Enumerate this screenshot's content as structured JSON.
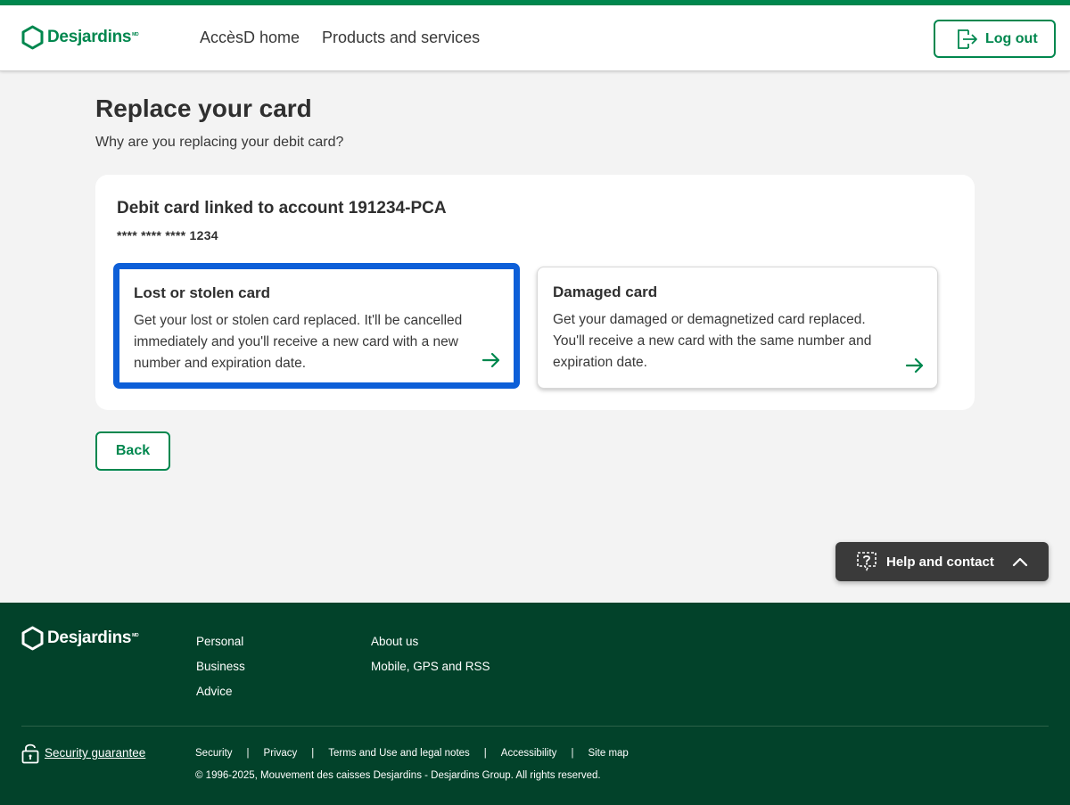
{
  "header": {
    "logo_text": "Desjardins",
    "logo_mark": "MD",
    "nav": [
      "AccèsD home",
      "Products and services"
    ],
    "logout_label": "Log out"
  },
  "main": {
    "title": "Replace your card",
    "subtitle": "Why are you replacing your debit card?",
    "panel": {
      "title": "Debit card linked to account 191234-PCA",
      "card_number": "**** **** **** 1234",
      "options": [
        {
          "title": "Lost or stolen card",
          "description": "Get your lost or stolen card replaced. It'll be cancelled immediately and you'll receive a new card with a new number and expiration date."
        },
        {
          "title": "Damaged card",
          "description": "Get your damaged or demagnetized card replaced. You'll receive a new card with the same number and expiration date."
        }
      ]
    },
    "back_label": "Back"
  },
  "help": {
    "label": "Help and contact"
  },
  "footer": {
    "logo_text": "Desjardins",
    "logo_mark": "MD",
    "col1": [
      "Personal",
      "Business",
      "Advice"
    ],
    "col2": [
      "About us",
      "Mobile, GPS and RSS"
    ],
    "security_label": "Security guarantee",
    "links": [
      "Security",
      "Privacy",
      "Terms and Use and legal notes",
      "Accessibility",
      "Site map"
    ],
    "copyright": "© 1996-2025, Mouvement des caisses Desjardins - Desjardins Group. All rights reserved."
  },
  "colors": {
    "brand_green": "#00874e",
    "footer_green": "#02422a",
    "focus_blue": "#0d5fd8",
    "help_bg": "#3a3a3a"
  },
  "icons": [
    "desjardins-hexagon-icon",
    "logout-icon",
    "arrow-right-icon",
    "help-question-icon",
    "chevron-up-icon",
    "lock-icon"
  ]
}
